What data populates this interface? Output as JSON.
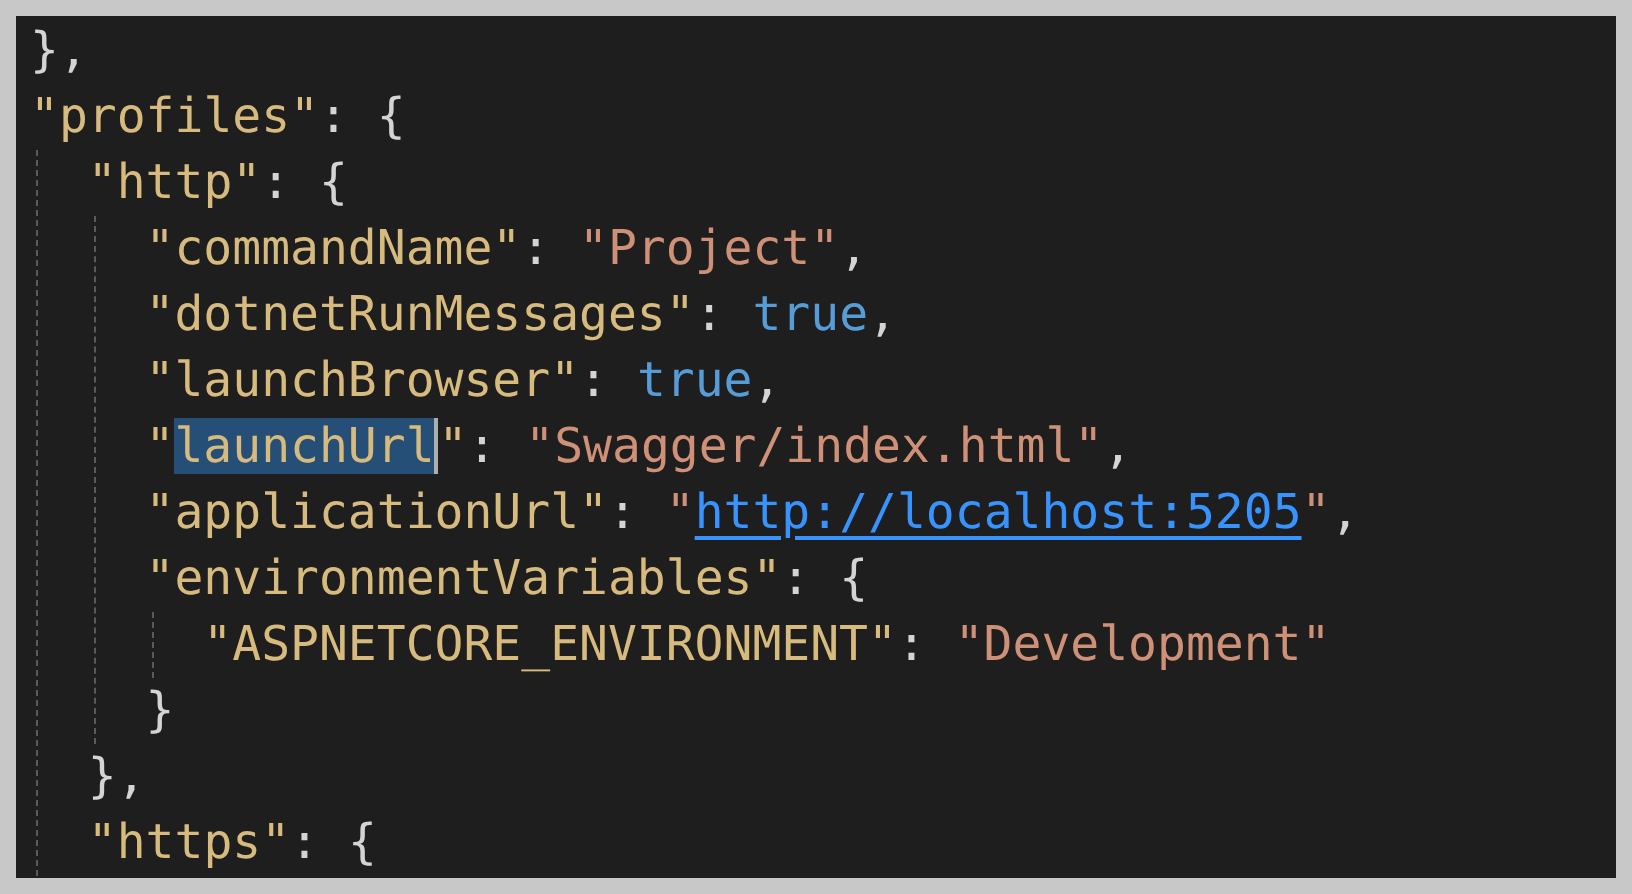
{
  "editor": {
    "lines": [
      {
        "tokens": [
          {
            "kind": "punct",
            "text": "},"
          }
        ]
      },
      {
        "tokens": [
          {
            "kind": "key",
            "text": "\"profiles\""
          },
          {
            "kind": "punct",
            "text": ": {"
          }
        ],
        "children": [
          {
            "tokens": [
              {
                "kind": "key",
                "text": "\"http\""
              },
              {
                "kind": "punct",
                "text": ": {"
              }
            ],
            "children": [
              {
                "tokens": [
                  {
                    "kind": "key",
                    "text": "\"commandName\""
                  },
                  {
                    "kind": "punct",
                    "text": ": "
                  },
                  {
                    "kind": "string",
                    "text": "\"Project\""
                  },
                  {
                    "kind": "punct",
                    "text": ","
                  }
                ]
              },
              {
                "tokens": [
                  {
                    "kind": "key",
                    "text": "\"dotnetRunMessages\""
                  },
                  {
                    "kind": "punct",
                    "text": ": "
                  },
                  {
                    "kind": "boolean",
                    "text": "true"
                  },
                  {
                    "kind": "punct",
                    "text": ","
                  }
                ]
              },
              {
                "tokens": [
                  {
                    "kind": "key",
                    "text": "\"launchBrowser\""
                  },
                  {
                    "kind": "punct",
                    "text": ": "
                  },
                  {
                    "kind": "boolean",
                    "text": "true"
                  },
                  {
                    "kind": "punct",
                    "text": ","
                  }
                ]
              },
              {
                "tokens": [
                  {
                    "kind": "key",
                    "text": "\""
                  },
                  {
                    "kind": "selection",
                    "text": "launchUrl"
                  },
                  {
                    "kind": "key",
                    "text": "\""
                  },
                  {
                    "kind": "punct",
                    "text": ": "
                  },
                  {
                    "kind": "string",
                    "text": "\"Swagger/index.html\""
                  },
                  {
                    "kind": "punct",
                    "text": ","
                  }
                ]
              },
              {
                "tokens": [
                  {
                    "kind": "key",
                    "text": "\"applicationUrl\""
                  },
                  {
                    "kind": "punct",
                    "text": ": "
                  },
                  {
                    "kind": "string",
                    "text": "\""
                  },
                  {
                    "kind": "link",
                    "text": "http://localhost:5205"
                  },
                  {
                    "kind": "string",
                    "text": "\""
                  },
                  {
                    "kind": "punct",
                    "text": ","
                  }
                ]
              },
              {
                "tokens": [
                  {
                    "kind": "key",
                    "text": "\"environmentVariables\""
                  },
                  {
                    "kind": "punct",
                    "text": ": {"
                  }
                ],
                "children": [
                  {
                    "tokens": [
                      {
                        "kind": "key",
                        "text": "\"ASPNETCORE_ENVIRONMENT\""
                      },
                      {
                        "kind": "punct",
                        "text": ": "
                      },
                      {
                        "kind": "string",
                        "text": "\"Development\""
                      }
                    ]
                  }
                ]
              },
              {
                "tokens": [
                  {
                    "kind": "punct",
                    "text": "}"
                  }
                ]
              }
            ]
          },
          {
            "tokens": [
              {
                "kind": "punct",
                "text": "},"
              }
            ]
          },
          {
            "tokens": [
              {
                "kind": "key",
                "text": "\"https\""
              },
              {
                "kind": "punct",
                "text": ": {"
              }
            ]
          }
        ]
      }
    ]
  }
}
